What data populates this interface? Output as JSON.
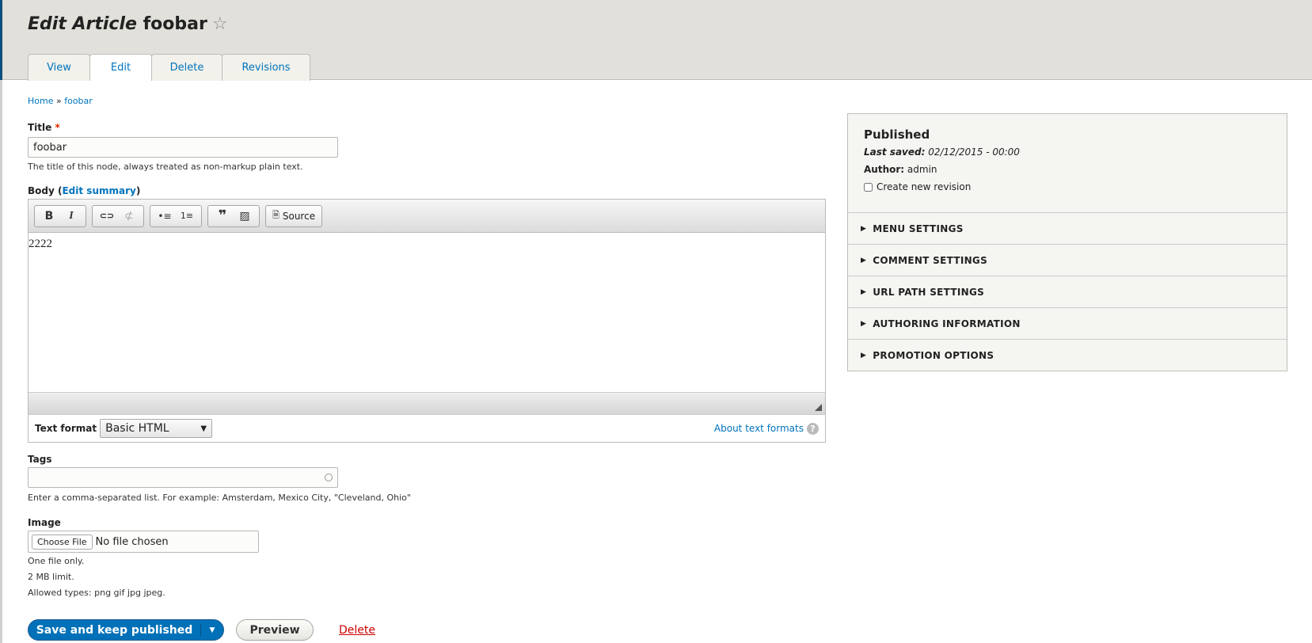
{
  "header": {
    "title_italic": "Edit Article",
    "title_rest": "foobar",
    "star_icon": "☆"
  },
  "tabs": [
    {
      "label": "View"
    },
    {
      "label": "Edit"
    },
    {
      "label": "Delete"
    },
    {
      "label": "Revisions"
    }
  ],
  "breadcrumb": {
    "home": "Home",
    "sep": "»",
    "current": "foobar"
  },
  "title_field": {
    "label": "Title",
    "required": "*",
    "value": "foobar",
    "description": "The title of this node, always treated as non-markup plain text."
  },
  "body_field": {
    "label": "Body",
    "paren_open": "(",
    "edit_summary": "Edit summary",
    "paren_close": ")",
    "content": "2222",
    "toolbar": {
      "bold": "B",
      "italic": "I",
      "link": "⊂⊃",
      "unlink": "⊄",
      "bullets": "•≡",
      "numbers": "1≡",
      "quote": "❞",
      "image": "▨",
      "source": "Source"
    },
    "text_format_label": "Text format",
    "text_format_value": "Basic HTML",
    "about_formats": "About text formats",
    "help": "?"
  },
  "tags_field": {
    "label": "Tags",
    "value": "",
    "description": "Enter a comma-separated list. For example: Amsterdam, Mexico City, \"Cleveland, Ohio\""
  },
  "image_field": {
    "label": "Image",
    "choose": "Choose File",
    "status": "No file chosen",
    "notes": [
      "One file only.",
      "2 MB limit.",
      "Allowed types: png gif jpg jpeg."
    ]
  },
  "actions": {
    "save": "Save and keep published",
    "preview": "Preview",
    "delete": "Delete"
  },
  "sidebar": {
    "status": "Published",
    "last_saved_label": "Last saved:",
    "last_saved": "02/12/2015 - 00:00",
    "author_label": "Author:",
    "author": "admin",
    "new_revision": "Create new revision",
    "sections": [
      "MENU SETTINGS",
      "COMMENT SETTINGS",
      "URL PATH SETTINGS",
      "AUTHORING INFORMATION",
      "PROMOTION OPTIONS"
    ]
  },
  "colors": {
    "accent": "#0074bd",
    "danger": "#e62600",
    "header_bg": "#e1e0da"
  }
}
